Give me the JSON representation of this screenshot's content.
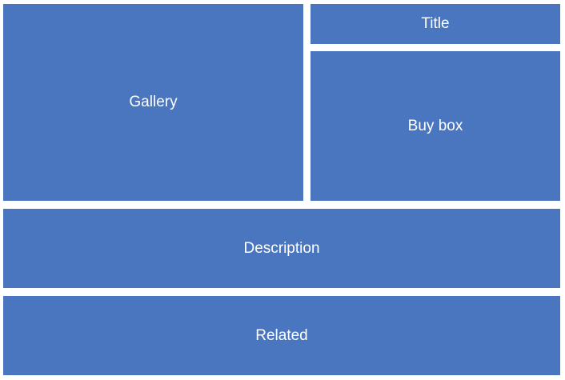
{
  "colors": {
    "block": "#4a76c0",
    "text": "#ffffff",
    "background": "#ffffff"
  },
  "blocks": {
    "gallery": "Gallery",
    "title": "Title",
    "buy_box": "Buy box",
    "description": "Description",
    "related": "Related"
  }
}
